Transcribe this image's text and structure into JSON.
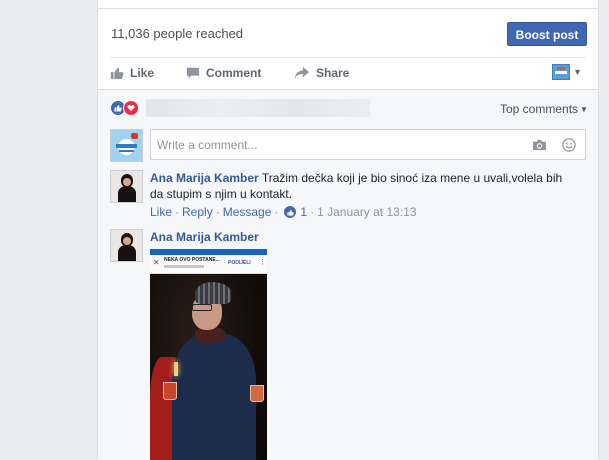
{
  "post": {
    "reach_text": "11,036 people reached",
    "boost_label": "Boost post"
  },
  "actions": {
    "like": "Like",
    "comment": "Comment",
    "share": "Share"
  },
  "comments_header": {
    "sort_label": "Top comments"
  },
  "composer": {
    "placeholder": "Write a comment..."
  },
  "comments": [
    {
      "author": "Ana Marija Kamber",
      "text_line1": "Tražim dečka koji je bio sinoć iza mene u uvali,volela bih",
      "text_line2": "da stupim s njim u kontakt.",
      "like": "Like",
      "reply": "Reply",
      "message": "Message",
      "reactions": "1",
      "timestamp": "1 January at 13:13"
    },
    {
      "author": "Ana Marija Kamber",
      "photo_header": "NEKA OVO POSTANE...",
      "photo_button": "PODIJELI"
    }
  ],
  "colors": {
    "link": "#365899",
    "button": "#4267b2"
  }
}
